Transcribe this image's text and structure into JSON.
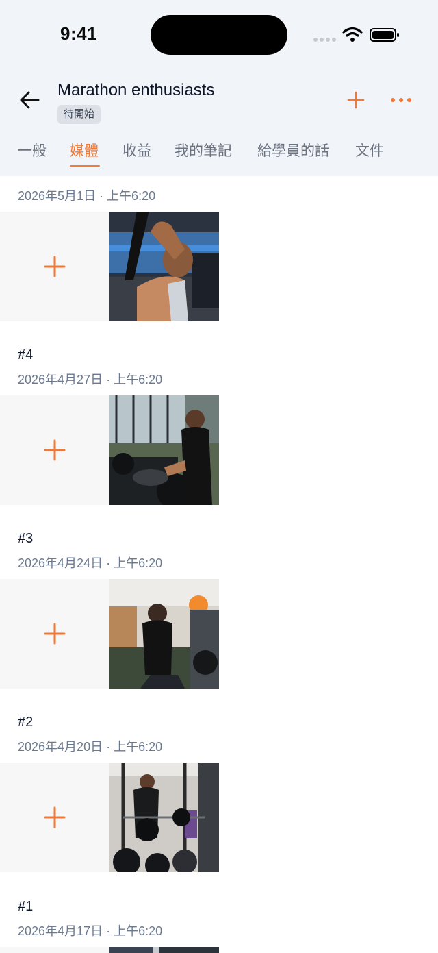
{
  "status_bar": {
    "time": "9:41"
  },
  "header": {
    "title": "Marathon enthusiasts",
    "status_badge": "待開始",
    "accent_color": "#f27935"
  },
  "tabs": [
    {
      "label": "一般",
      "active": false
    },
    {
      "label": "媒體",
      "active": true
    },
    {
      "label": "收益",
      "active": false
    },
    {
      "label": "我的筆記",
      "active": false
    },
    {
      "label": "給學員的話",
      "active": false
    },
    {
      "label": "文件",
      "active": false
    }
  ],
  "sessions": [
    {
      "number": "",
      "date": "2026年5月1日 · 上午6:20",
      "photo": "trainee-tricep-pulldown"
    },
    {
      "number": "#4",
      "date": "2026年4月27日 · 上午6:20",
      "photo": "coach-spotting-bench-press"
    },
    {
      "number": "#3",
      "date": "2026年4月24日 · 上午6:20",
      "photo": "coach-machine-assist"
    },
    {
      "number": "#2",
      "date": "2026年4月20日 · 上午6:20",
      "photo": "coach-loading-barbell"
    },
    {
      "number": "#1",
      "date": "2026年4月17日 · 上午6:20",
      "photo": ""
    }
  ]
}
